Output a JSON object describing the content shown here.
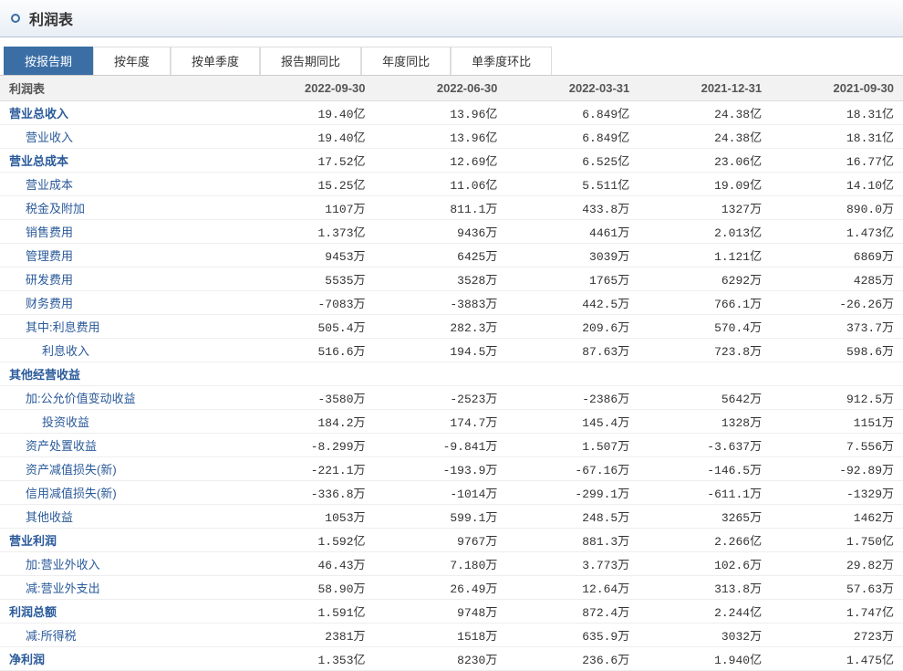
{
  "header": {
    "title": "利润表"
  },
  "tabs": [
    {
      "label": "按报告期",
      "active": true
    },
    {
      "label": "按年度",
      "active": false
    },
    {
      "label": "按单季度",
      "active": false
    },
    {
      "label": "报告期同比",
      "active": false
    },
    {
      "label": "年度同比",
      "active": false
    },
    {
      "label": "单季度环比",
      "active": false
    }
  ],
  "table": {
    "head": [
      "利润表",
      "2022-09-30",
      "2022-06-30",
      "2022-03-31",
      "2021-12-31",
      "2021-09-30"
    ],
    "rows": [
      {
        "label": "营业总收入",
        "bold": true,
        "indent": 0,
        "v": [
          "19.40亿",
          "13.96亿",
          "6.849亿",
          "24.38亿",
          "18.31亿"
        ]
      },
      {
        "label": "营业收入",
        "bold": false,
        "indent": 1,
        "v": [
          "19.40亿",
          "13.96亿",
          "6.849亿",
          "24.38亿",
          "18.31亿"
        ]
      },
      {
        "label": "营业总成本",
        "bold": true,
        "indent": 0,
        "v": [
          "17.52亿",
          "12.69亿",
          "6.525亿",
          "23.06亿",
          "16.77亿"
        ]
      },
      {
        "label": "营业成本",
        "bold": false,
        "indent": 1,
        "v": [
          "15.25亿",
          "11.06亿",
          "5.511亿",
          "19.09亿",
          "14.10亿"
        ]
      },
      {
        "label": "税金及附加",
        "bold": false,
        "indent": 1,
        "v": [
          "1107万",
          "811.1万",
          "433.8万",
          "1327万",
          "890.0万"
        ]
      },
      {
        "label": "销售费用",
        "bold": false,
        "indent": 1,
        "v": [
          "1.373亿",
          "9436万",
          "4461万",
          "2.013亿",
          "1.473亿"
        ]
      },
      {
        "label": "管理费用",
        "bold": false,
        "indent": 1,
        "v": [
          "9453万",
          "6425万",
          "3039万",
          "1.121亿",
          "6869万"
        ]
      },
      {
        "label": "研发费用",
        "bold": false,
        "indent": 1,
        "v": [
          "5535万",
          "3528万",
          "1765万",
          "6292万",
          "4285万"
        ]
      },
      {
        "label": "财务费用",
        "bold": false,
        "indent": 1,
        "v": [
          "-7083万",
          "-3883万",
          "442.5万",
          "766.1万",
          "-26.26万"
        ]
      },
      {
        "label": "其中:利息费用",
        "bold": false,
        "indent": 1,
        "v": [
          "505.4万",
          "282.3万",
          "209.6万",
          "570.4万",
          "373.7万"
        ]
      },
      {
        "label": "利息收入",
        "bold": false,
        "indent": 2,
        "v": [
          "516.6万",
          "194.5万",
          "87.63万",
          "723.8万",
          "598.6万"
        ]
      },
      {
        "label": "其他经营收益",
        "bold": true,
        "indent": 0,
        "v": [
          "",
          "",
          "",
          "",
          ""
        ]
      },
      {
        "label": "加:公允价值变动收益",
        "bold": false,
        "indent": 1,
        "v": [
          "-3580万",
          "-2523万",
          "-2386万",
          "5642万",
          "912.5万"
        ]
      },
      {
        "label": "投资收益",
        "bold": false,
        "indent": 2,
        "v": [
          "184.2万",
          "174.7万",
          "145.4万",
          "1328万",
          "1151万"
        ]
      },
      {
        "label": "资产处置收益",
        "bold": false,
        "indent": 1,
        "v": [
          "-8.299万",
          "-9.841万",
          "1.507万",
          "-3.637万",
          "7.556万"
        ]
      },
      {
        "label": "资产减值损失(新)",
        "bold": false,
        "indent": 1,
        "v": [
          "-221.1万",
          "-193.9万",
          "-67.16万",
          "-146.5万",
          "-92.89万"
        ]
      },
      {
        "label": "信用减值损失(新)",
        "bold": false,
        "indent": 1,
        "v": [
          "-336.8万",
          "-1014万",
          "-299.1万",
          "-611.1万",
          "-1329万"
        ]
      },
      {
        "label": "其他收益",
        "bold": false,
        "indent": 1,
        "v": [
          "1053万",
          "599.1万",
          "248.5万",
          "3265万",
          "1462万"
        ]
      },
      {
        "label": "营业利润",
        "bold": true,
        "indent": 0,
        "v": [
          "1.592亿",
          "9767万",
          "881.3万",
          "2.266亿",
          "1.750亿"
        ]
      },
      {
        "label": "加:营业外收入",
        "bold": false,
        "indent": 1,
        "v": [
          "46.43万",
          "7.180万",
          "3.773万",
          "102.6万",
          "29.82万"
        ]
      },
      {
        "label": "减:营业外支出",
        "bold": false,
        "indent": 1,
        "v": [
          "58.90万",
          "26.49万",
          "12.64万",
          "313.8万",
          "57.63万"
        ]
      },
      {
        "label": "利润总额",
        "bold": true,
        "indent": 0,
        "v": [
          "1.591亿",
          "9748万",
          "872.4万",
          "2.244亿",
          "1.747亿"
        ]
      },
      {
        "label": "减:所得税",
        "bold": false,
        "indent": 1,
        "v": [
          "2381万",
          "1518万",
          "635.9万",
          "3032万",
          "2723万"
        ]
      },
      {
        "label": "净利润",
        "bold": true,
        "indent": 0,
        "v": [
          "1.353亿",
          "8230万",
          "236.6万",
          "1.940亿",
          "1.475亿"
        ]
      }
    ]
  }
}
